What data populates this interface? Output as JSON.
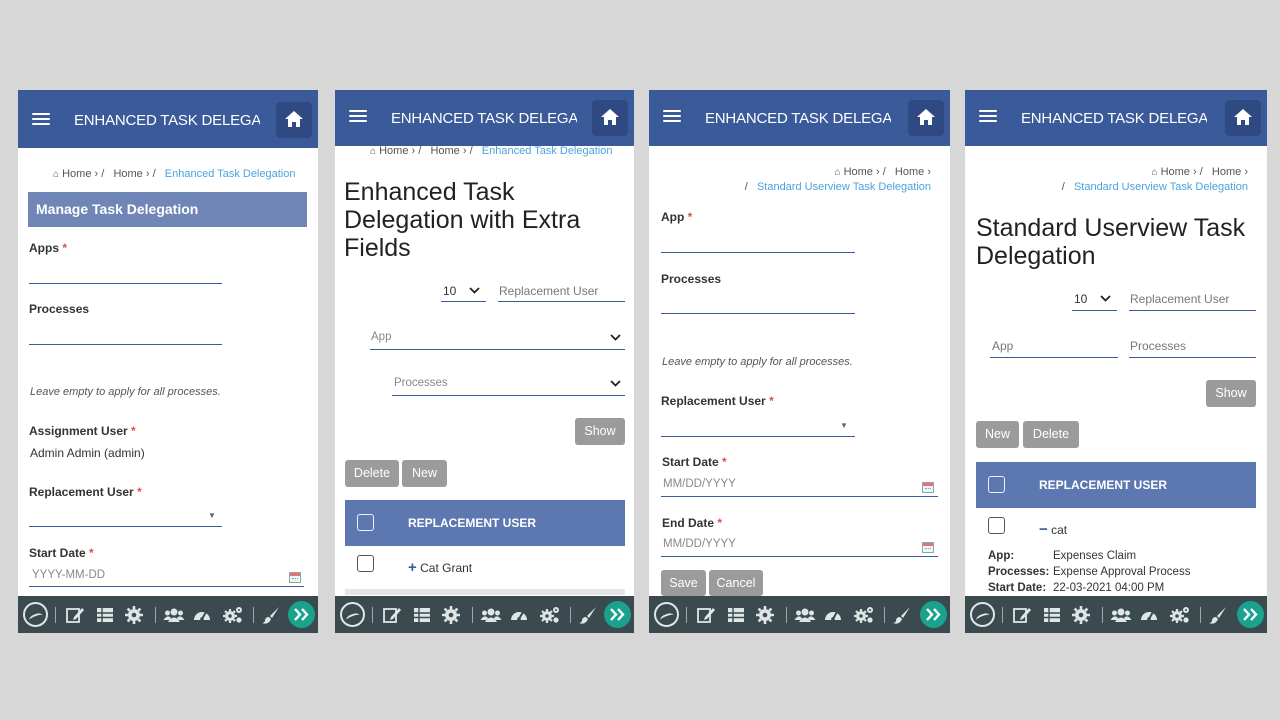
{
  "screens": [
    {
      "app_title": "ENHANCED TASK DELEGATI",
      "breadcrumb": {
        "home": "Home",
        "sep1": "›",
        "item1": "Home",
        "sep2": "›",
        "current": "Enhanced Task Delegation"
      },
      "panel_title": "Manage Task Delegation",
      "fields": {
        "apps_label": "Apps",
        "processes_label": "Processes",
        "hint": "Leave empty to apply for all processes.",
        "assignment_user_label": "Assignment User",
        "assignment_user_value": "Admin Admin (admin)",
        "replacement_user_label": "Replacement User",
        "start_date_label": "Start Date",
        "start_date_placeholder": "YYYY-MM-DD"
      },
      "required_mark": "*"
    },
    {
      "app_title": "ENHANCED TASK DELEGATI",
      "breadcrumb": {
        "home": "Home",
        "item1": "Home",
        "current": "Enhanced Task Delegation"
      },
      "page_title": "Enhanced Task Delegation with Extra Fields",
      "filters": {
        "page_size": "10",
        "replacement_user_placeholder": "Replacement User",
        "app_placeholder": "App",
        "processes_placeholder": "Processes"
      },
      "buttons": {
        "show": "Show",
        "delete": "Delete",
        "new": "New"
      },
      "table": {
        "column": "REPLACEMENT USER",
        "rows": [
          {
            "label": "Cat Grant",
            "expander": "+"
          }
        ]
      }
    },
    {
      "app_title": "ENHANCED TASK DELEGATI",
      "breadcrumb": {
        "home": "Home",
        "item1": "Home",
        "current": "Standard Userview Task Delegation"
      },
      "fields": {
        "app_label": "App",
        "processes_label": "Processes",
        "hint": "Leave empty to apply for all processes.",
        "replacement_user_label": "Replacement User",
        "start_date_label": "Start Date",
        "start_date_placeholder": "MM/DD/YYYY",
        "end_date_label": "End Date",
        "end_date_placeholder": "MM/DD/YYYY"
      },
      "buttons": {
        "save": "Save",
        "cancel": "Cancel"
      }
    },
    {
      "app_title": "ENHANCED TASK DELEGATI",
      "breadcrumb": {
        "home": "Home",
        "item1": "Home",
        "current": "Standard Userview Task Delegation"
      },
      "page_title": "Standard Userview Task Delegation",
      "filters": {
        "page_size": "10",
        "replacement_user_placeholder": "Replacement User",
        "app_placeholder": "App",
        "processes_placeholder": "Processes"
      },
      "buttons": {
        "show": "Show",
        "new": "New",
        "delete": "Delete"
      },
      "table": {
        "column": "REPLACEMENT USER",
        "rows": [
          {
            "label": "cat",
            "expander": "−"
          }
        ]
      },
      "details": {
        "app_label": "App:",
        "app_value": "Expenses Claim",
        "processes_label": "Processes:",
        "processes_value": "Expense Approval Process",
        "start_date_label": "Start Date:",
        "start_date_value": "22-03-2021 04:00 PM"
      }
    }
  ],
  "bottom_bar_icons": [
    "logo-icon",
    "edit-icon",
    "list-icon",
    "gear-icon",
    "users-icon",
    "dashboard-icon",
    "cogs-icon",
    "brush-icon",
    "double-chevron-right-icon"
  ],
  "colors": {
    "header": "#3b5a99",
    "panel": "#6f86b6",
    "link": "#4aa3df",
    "bottom_bar": "#3a4a4f",
    "next_button": "#1aa28e",
    "button": "#9b9b9b",
    "required": "#d9534f"
  }
}
